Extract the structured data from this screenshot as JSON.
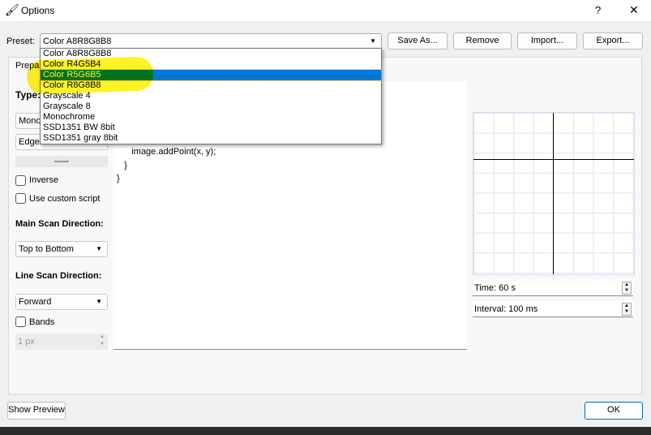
{
  "window": {
    "title": "Options",
    "help": "?",
    "close": "✕"
  },
  "preset": {
    "label": "Preset:",
    "value": "Color A8R8G8B8",
    "options": [
      "Color A8R8G8B8",
      "Color R4G5B4",
      "Color R5G6B5",
      "Color R8G8B8",
      "Grayscale 4",
      "Grayscale 8",
      "Monochrome",
      "SSD1351 BW 8bit",
      "SSD1351 gray 8bit"
    ],
    "highlighted": "Color R5G6B5"
  },
  "buttons": {
    "save_as": "Save As...",
    "remove": "Remove",
    "import": "Import...",
    "export": "Export...",
    "show_preview": "Show Preview",
    "ok": "OK"
  },
  "tab": {
    "label": "Prepare"
  },
  "left": {
    "type_label": "Type:",
    "type_value": "Mono",
    "edge_value": "Edge",
    "inverse": "Inverse",
    "custom_script": "Use custom script",
    "main_scan_label": "Main Scan Direction:",
    "main_scan_value": "Top to Bottom",
    "line_scan_label": "Line Scan Direction:",
    "line_scan_value": "Forward",
    "bands": "Bands",
    "bands_width": "1 px"
  },
  "editor": {
    "code": "for (var y = 0; y < image.height; y++) {\n   for (var x = 0; x < image.width; x++) {\n      image.addPoint(x, y);\n   }\n}"
  },
  "preview": {
    "time": "Time: 60 s",
    "interval": "Interval: 100 ms"
  },
  "colors": {
    "selection": "#0078d7",
    "highlighter": "#ffef00"
  }
}
